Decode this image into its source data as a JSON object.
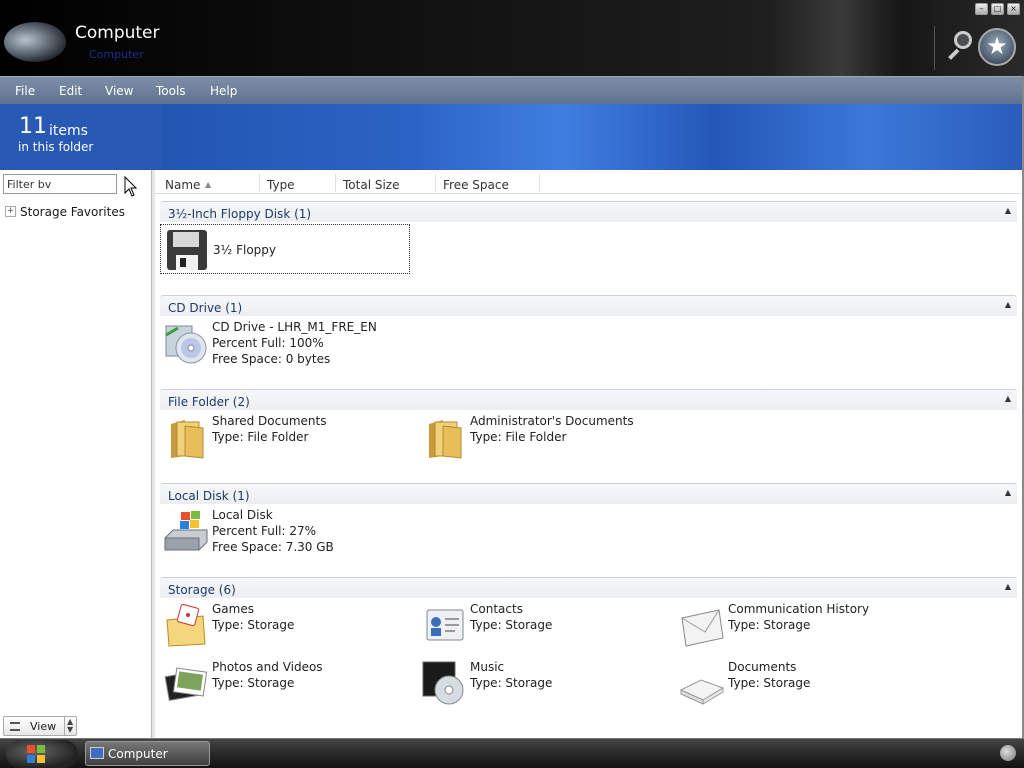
{
  "window": {
    "title": "Computer",
    "title_hint": "Computer",
    "controls": {
      "minimize": "–",
      "maximize": "□",
      "close": "×"
    }
  },
  "menu": [
    "File",
    "Edit",
    "View",
    "Tools",
    "Help"
  ],
  "banner": {
    "count": "11",
    "count_label": "items",
    "sub_label": "in this folder"
  },
  "left_pane": {
    "filter_value": "Filter bv",
    "favorites_label": "Storage Favorites",
    "favorites_expander": "+",
    "view_button": "View"
  },
  "columns": [
    "Name",
    "Type",
    "Total Size",
    "Free Space"
  ],
  "groups": [
    {
      "title": "3½-Inch Floppy Disk (1)",
      "items": [
        {
          "icon": "floppy-icon",
          "lines": [
            "3½ Floppy"
          ],
          "selected": true
        }
      ]
    },
    {
      "title": "CD Drive (1)",
      "items": [
        {
          "icon": "cd-drive-icon",
          "lines": [
            "CD Drive - LHR_M1_FRE_EN",
            "Percent Full: 100%",
            "Free Space: 0 bytes"
          ]
        }
      ]
    },
    {
      "title": "File Folder (2)",
      "items": [
        {
          "icon": "folder-icon",
          "lines": [
            "Shared Documents",
            "Type: File Folder"
          ]
        },
        {
          "icon": "folder-icon",
          "lines": [
            "Administrator's Documents",
            "Type: File Folder"
          ]
        }
      ]
    },
    {
      "title": "Local Disk (1)",
      "items": [
        {
          "icon": "local-disk-icon",
          "lines": [
            "Local Disk",
            "Percent Full: 27%",
            "Free Space: 7.30 GB"
          ]
        }
      ]
    },
    {
      "title": "Storage (6)",
      "items": [
        {
          "icon": "games-icon",
          "lines": [
            "Games",
            "Type: Storage"
          ]
        },
        {
          "icon": "contacts-icon",
          "lines": [
            "Contacts",
            "Type: Storage"
          ]
        },
        {
          "icon": "communication-history-icon",
          "lines": [
            "Communication History",
            "Type: Storage"
          ]
        },
        {
          "icon": "photos-videos-icon",
          "lines": [
            "Photos and Videos",
            "Type: Storage"
          ]
        },
        {
          "icon": "music-icon",
          "lines": [
            "Music",
            "Type: Storage"
          ]
        },
        {
          "icon": "documents-icon",
          "lines": [
            "Documents",
            "Type: Storage"
          ]
        }
      ]
    }
  ],
  "taskbar": {
    "task_label": "Computer"
  },
  "colors": {
    "menu": "#6f819c",
    "banner": "#2b63c4",
    "group_title": "#1c3a6a"
  }
}
